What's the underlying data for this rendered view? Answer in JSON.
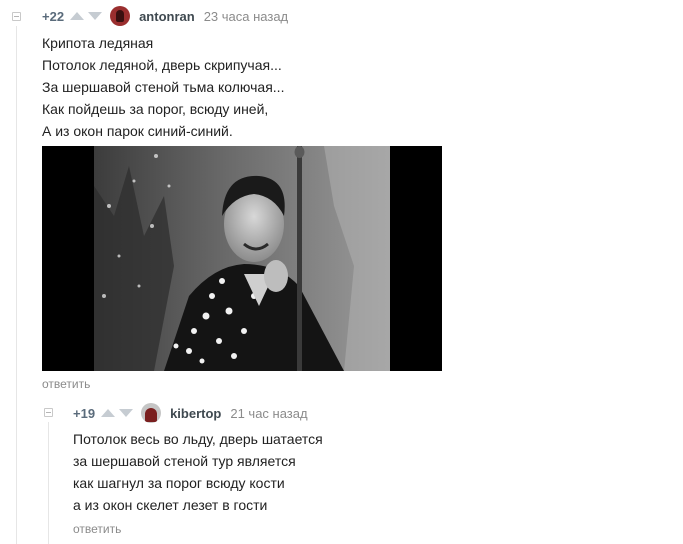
{
  "comments": [
    {
      "rating": "+22",
      "username": "antonran",
      "timestamp": "23 часа назад",
      "lines": [
        "Крипота ледяная",
        "Потолок ледяной, дверь скрипучая...",
        "За шершавой стеной тьма колючая...",
        "Как пойдешь за порог, всюду иней,",
        "А из окон парок синий-синий."
      ],
      "reply_label": "ответить"
    },
    {
      "rating": "+19",
      "username": "kibertop",
      "timestamp": "21 час назад",
      "lines": [
        "Потолок весь во льду, дверь шатается",
        "за шершавой стеной тур является",
        "как шагнул за порог всюду кости",
        "а из окон скелет лезет в гости"
      ],
      "reply_label": "ответить"
    }
  ],
  "icons": {
    "collapse": "collapse-toggle-icon",
    "upvote": "upvote-arrow-icon",
    "downvote": "downvote-arrow-icon"
  },
  "colors": {
    "rating": "#5a6b7b",
    "username": "#3f4950",
    "timestamp": "#8b8b8b",
    "reply": "#8a8a8a",
    "vote_arrow": "#c6ccd2"
  }
}
